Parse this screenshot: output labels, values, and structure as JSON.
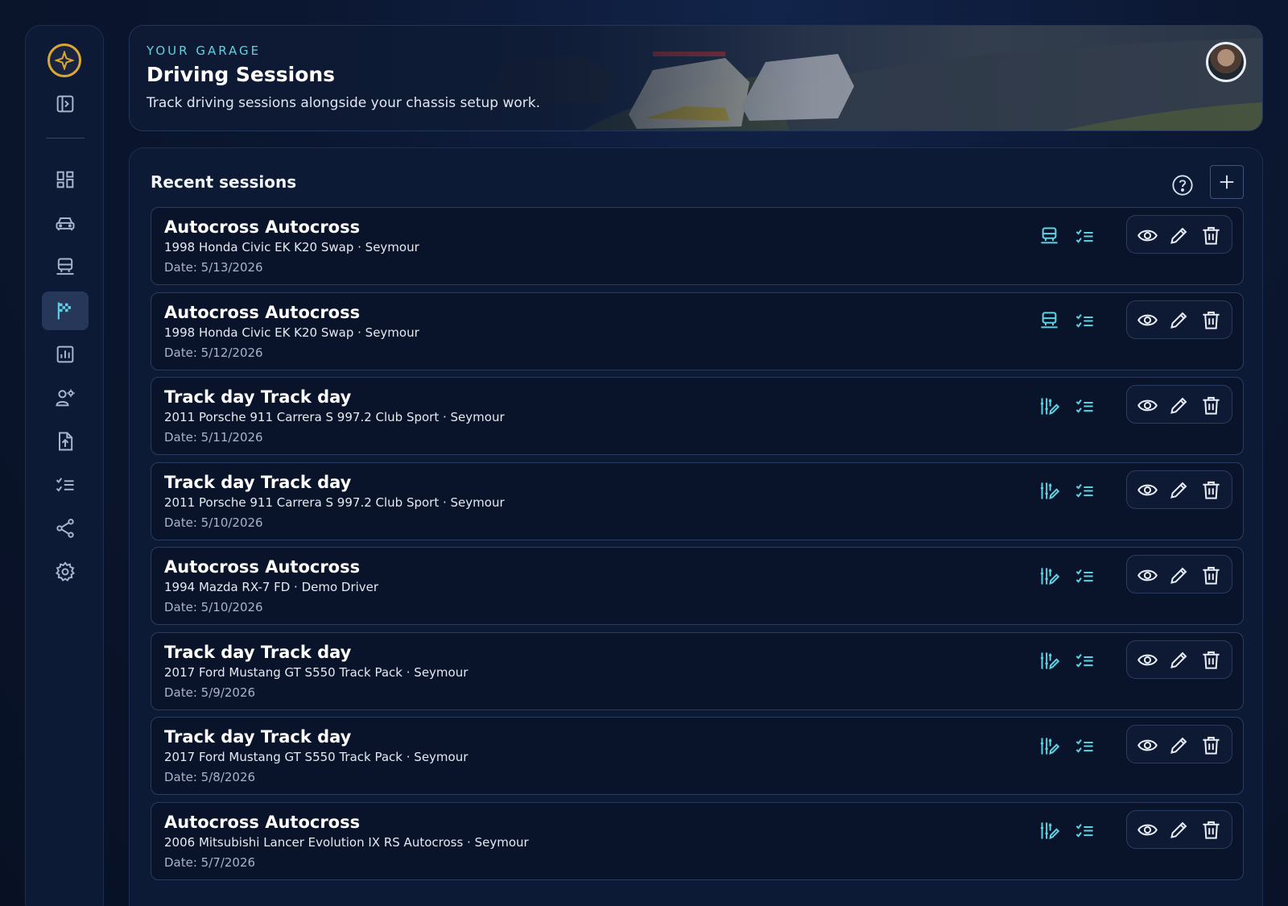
{
  "hero": {
    "eyebrow": "YOUR GARAGE",
    "title": "Driving Sessions",
    "subtitle": "Track driving sessions alongside your chassis setup work."
  },
  "sidebar": {
    "items": [
      {
        "icon": "panel-toggle-icon"
      },
      {
        "icon": "dashboard-icon"
      },
      {
        "icon": "car-icon"
      },
      {
        "icon": "setup-icon"
      },
      {
        "icon": "checkered-flag-icon",
        "active": true
      },
      {
        "icon": "analytics-icon"
      },
      {
        "icon": "drivers-icon"
      },
      {
        "icon": "upload-icon"
      },
      {
        "icon": "checklist-icon"
      },
      {
        "icon": "share-icon"
      },
      {
        "icon": "settings-icon"
      }
    ]
  },
  "panel": {
    "title": "Recent sessions"
  },
  "sessions": [
    {
      "title": "Autocross Autocross",
      "car": "1998 Honda Civic EK K20 Swap · Seymour",
      "date": "Date: 5/13/2026",
      "type_icon": "setup-icon"
    },
    {
      "title": "Autocross Autocross",
      "car": "1998 Honda Civic EK K20 Swap · Seymour",
      "date": "Date: 5/12/2026",
      "type_icon": "setup-icon"
    },
    {
      "title": "Track day Track day",
      "car": "2011 Porsche 911 Carrera S 997.2 Club Sport · Seymour",
      "date": "Date: 5/11/2026",
      "type_icon": "tuning-icon"
    },
    {
      "title": "Track day Track day",
      "car": "2011 Porsche 911 Carrera S 997.2 Club Sport · Seymour",
      "date": "Date: 5/10/2026",
      "type_icon": "tuning-icon"
    },
    {
      "title": "Autocross Autocross",
      "car": "1994 Mazda RX-7 FD · Demo Driver",
      "date": "Date: 5/10/2026",
      "type_icon": "tuning-icon"
    },
    {
      "title": "Track day Track day",
      "car": "2017 Ford Mustang GT S550 Track Pack · Seymour",
      "date": "Date: 5/9/2026",
      "type_icon": "tuning-icon"
    },
    {
      "title": "Track day Track day",
      "car": "2017 Ford Mustang GT S550 Track Pack · Seymour",
      "date": "Date: 5/8/2026",
      "type_icon": "tuning-icon"
    },
    {
      "title": "Autocross Autocross",
      "car": "2006 Mitsubishi Lancer Evolution IX RS Autocross · Seymour",
      "date": "Date: 5/7/2026",
      "type_icon": "tuning-icon"
    }
  ],
  "colors": {
    "accent": "#5fd2e2",
    "logo_gold": "#d9a933"
  }
}
